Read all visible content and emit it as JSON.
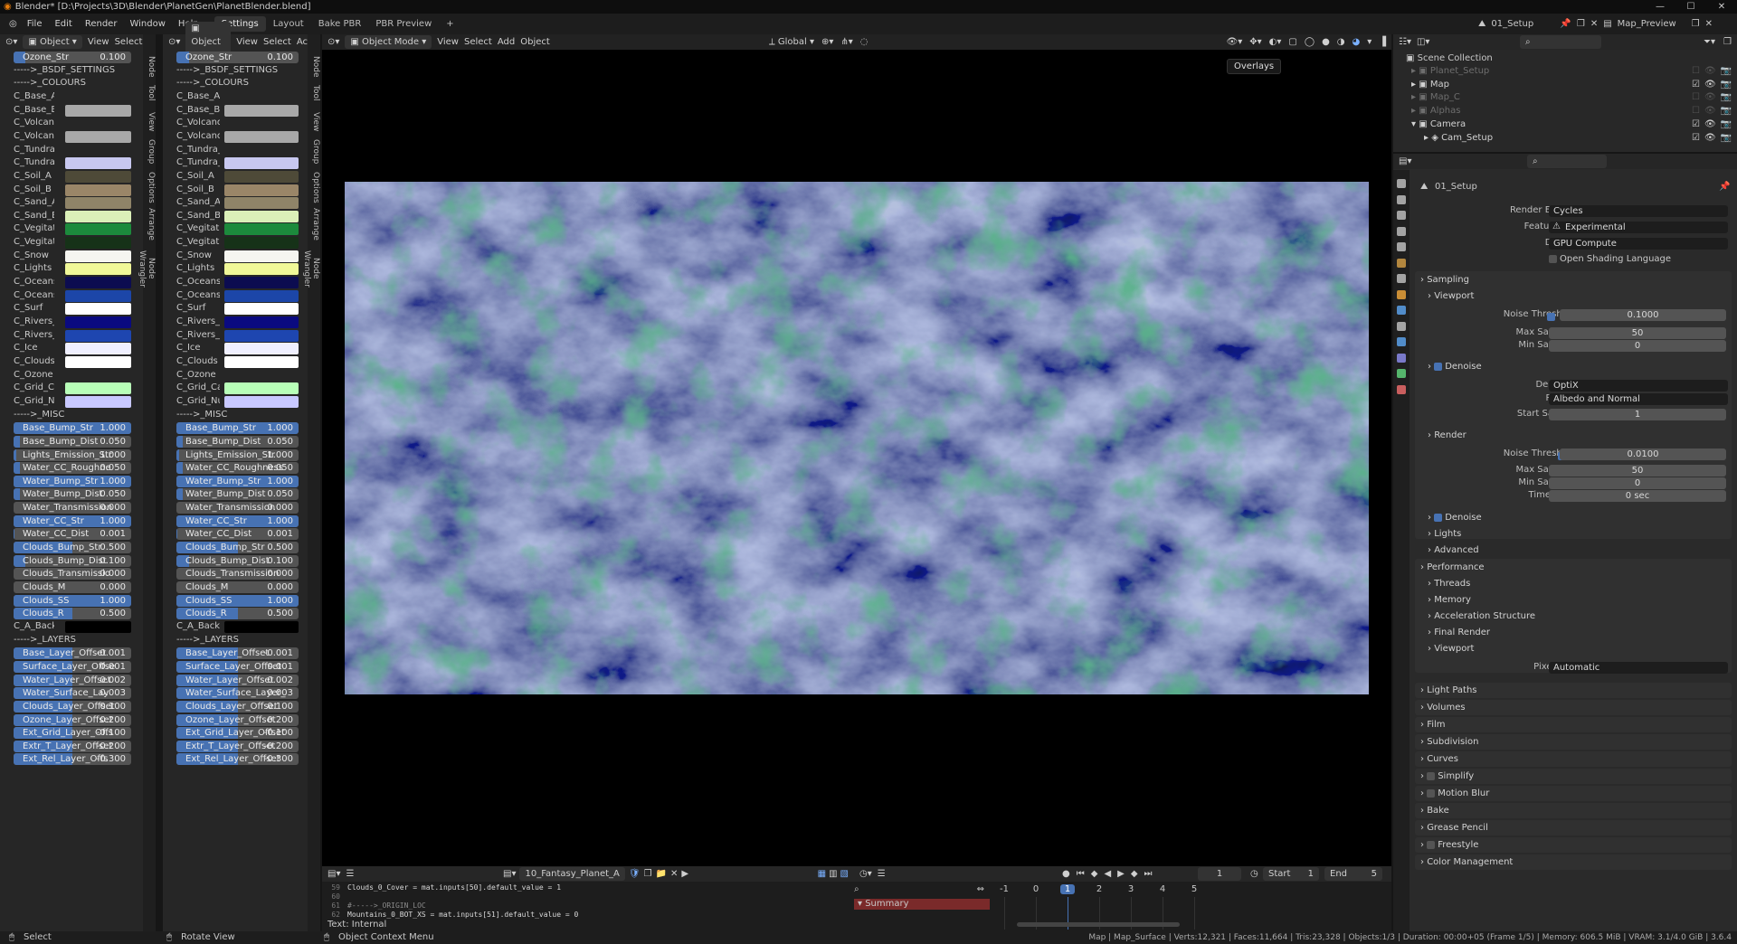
{
  "title": "Blender* [D:\\Projects\\3D\\Blender\\PlanetGen\\PlanetBlender.blend]",
  "menu": [
    "File",
    "Edit",
    "Render",
    "Window",
    "Help"
  ],
  "workspaces": [
    "Settings",
    "Layout",
    "Bake PBR",
    "PBR Preview"
  ],
  "scene": "01_Setup",
  "view_layer": "Map_Preview",
  "left_panels": [
    {
      "header": {
        "mode": "Object",
        "view": "View",
        "select": "Select"
      }
    },
    {
      "header": {
        "mode": "Object",
        "view": "View",
        "select": "Select",
        "extra": "Ac"
      }
    }
  ],
  "panel_rows": [
    {
      "type": "slider",
      "label": "Ozone_Str",
      "value": "0.100",
      "fill": 0.1,
      "alt_label": "Ozone_Str"
    },
    {
      "type": "text",
      "label": "----->_BSDF_SETTINGS"
    },
    {
      "type": "text",
      "label": "----->_COLOURS"
    },
    {
      "type": "color",
      "label": "C_Base_A",
      "color": "#262626"
    },
    {
      "type": "color",
      "label": "C_Base_B",
      "color": "#a8a8a8"
    },
    {
      "type": "color",
      "label": "C_Volcan...",
      "alt_label": "C_Volcano...",
      "color": "#262626"
    },
    {
      "type": "color",
      "label": "C_Volcan...",
      "alt_label": "C_Volcano...",
      "color": "#a8a8a8"
    },
    {
      "type": "color",
      "label": "C_Tundra_A",
      "color": "#262626"
    },
    {
      "type": "color",
      "label": "C_Tundra_B",
      "color": "#c8c8f0"
    },
    {
      "type": "color",
      "label": "C_Soil_A",
      "color": "#4e4a38"
    },
    {
      "type": "color",
      "label": "C_Soil_B",
      "color": "#9a8668"
    },
    {
      "type": "color",
      "label": "C_Sand_A",
      "color": "#8f8468"
    },
    {
      "type": "color",
      "label": "C_Sand_B",
      "color": "#dbf0b8"
    },
    {
      "type": "color",
      "label": "C_Vegitati...",
      "color": "#1c8a3c"
    },
    {
      "type": "color",
      "label": "C_Vegitati...",
      "color": "#163218"
    },
    {
      "type": "color",
      "label": "C_Snow",
      "color": "#f5f5f0"
    },
    {
      "type": "color",
      "label": "C_Lights",
      "color": "#f0f898"
    },
    {
      "type": "color",
      "label": "C_Oceans_A",
      "color": "#0c0c50"
    },
    {
      "type": "color",
      "label": "C_Oceans_B",
      "color": "#1c46a8"
    },
    {
      "type": "color",
      "label": "C_Surf",
      "color": "#ffffff"
    },
    {
      "type": "color",
      "label": "C_Rivers_A",
      "color": "#0a0a80"
    },
    {
      "type": "color",
      "label": "C_Rivers_B",
      "color": "#1e46b0"
    },
    {
      "type": "color",
      "label": "C_Ice",
      "color": "#f0f0ff"
    },
    {
      "type": "color",
      "label": "C_Clouds",
      "color": "#ffffff"
    },
    {
      "type": "color",
      "label": "C_Ozone",
      "color": "#262626"
    },
    {
      "type": "color",
      "label": "C_Grid_Ca...",
      "alt_label": "C_Grid_Car...",
      "color": "#b8ffb8"
    },
    {
      "type": "color",
      "label": "C_Grid_Nu...",
      "color": "#c8c8ff"
    },
    {
      "type": "text",
      "label": "----->_MISC"
    },
    {
      "type": "slider",
      "label": "Base_Bump_Str",
      "value": "1.000",
      "fill": 1
    },
    {
      "type": "slider",
      "label": "Base_Bump_Dist",
      "value": "0.050",
      "fill": 0.05
    },
    {
      "type": "slider",
      "label": "Lights_Emission_Str",
      "value": "1.000",
      "fill": 0.02
    },
    {
      "type": "slider",
      "label": "Water_CC_Roughne",
      "alt_label": "Water_CC_Roughness",
      "value": "0.050",
      "fill": 0.05
    },
    {
      "type": "slider",
      "label": "Water_Bump_Str",
      "value": "1.000",
      "fill": 1
    },
    {
      "type": "slider",
      "label": "Water_Bump_Dist",
      "value": "0.050",
      "fill": 0.05
    },
    {
      "type": "slider",
      "label": "Water_Transmission",
      "value": "0.000",
      "fill": 0
    },
    {
      "type": "slider",
      "label": "Water_CC_Str",
      "value": "1.000",
      "fill": 1
    },
    {
      "type": "slider",
      "label": "Water_CC_Dist",
      "value": "0.001",
      "fill": 0.001
    },
    {
      "type": "slider",
      "label": "Clouds_Bump_Str",
      "value": "0.500",
      "fill": 0.5
    },
    {
      "type": "slider",
      "label": "Clouds_Bump_Dist",
      "value": "0.100",
      "fill": 0.1
    },
    {
      "type": "slider",
      "label": "Clouds_Transmissio",
      "alt_label": "Clouds_Transmission",
      "value": "0.000",
      "fill": 0
    },
    {
      "type": "slider",
      "label": "Clouds_M",
      "value": "0.000",
      "fill": 0
    },
    {
      "type": "slider",
      "label": "Clouds_SS",
      "value": "1.000",
      "fill": 1
    },
    {
      "type": "slider",
      "label": "Clouds_R",
      "value": "0.500",
      "fill": 0.5
    },
    {
      "type": "color",
      "label": "C_A_Back...",
      "alt_label": "C_A_Backg...",
      "color": "#000000"
    },
    {
      "type": "text",
      "label": "----->_LAYERS"
    },
    {
      "type": "slider",
      "label": "Base_Layer_Offset",
      "value": "-0.001",
      "fill": 0.5
    },
    {
      "type": "slider",
      "label": "Surface_Layer_Offse",
      "alt_label": "Surface_Layer_Offset",
      "value": "0.001",
      "fill": 0.5
    },
    {
      "type": "slider",
      "label": "Water_Layer_Offset",
      "value": "0.002",
      "fill": 0.5
    },
    {
      "type": "slider",
      "label": "Water_Surface_Lay",
      "alt_label": "Water_Surface_Layer_",
      "value": "0.003",
      "fill": 0.5
    },
    {
      "type": "slider",
      "label": "Clouds_Layer_Offset",
      "value": "0.100",
      "fill": 0.5
    },
    {
      "type": "slider",
      "label": "Ozone_Layer_Offset",
      "value": "0.200",
      "fill": 0.5
    },
    {
      "type": "slider",
      "label": "Ext_Grid_Layer_Offs",
      "alt_label": "Ext_Grid_Layer_Offset",
      "value": "-0.100",
      "fill": 0.5
    },
    {
      "type": "slider",
      "label": "Extr_T_Layer_Offset",
      "value": "-0.200",
      "fill": 0.5
    },
    {
      "type": "slider",
      "label": "Ext_Rel_Layer_Offs",
      "alt_label": "Ext_Rel_Layer_Offset",
      "value": "-0.300",
      "fill": 0.5
    }
  ],
  "side_tabs": [
    "Node",
    "Tool",
    "View",
    "Group",
    "Options",
    "Arrange",
    "Node Wrangler"
  ],
  "viewport": {
    "mode": "Object Mode",
    "menus": [
      "View",
      "Select",
      "Add",
      "Object"
    ],
    "transform": "Global",
    "tooltip": "Overlays"
  },
  "outliner": {
    "root": "Scene Collection",
    "items": [
      {
        "name": "Planet_Setup",
        "indent": 1,
        "dim": true
      },
      {
        "name": "Map",
        "indent": 1,
        "dim": false
      },
      {
        "name": "Map_C",
        "indent": 1,
        "dim": true
      },
      {
        "name": "Alphas",
        "indent": 1,
        "dim": true
      },
      {
        "name": "Camera",
        "indent": 1,
        "dim": false
      },
      {
        "name": "Cam_Setup",
        "indent": 2,
        "dim": false
      }
    ]
  },
  "properties": {
    "scene_name": "01_Setup",
    "render_engine_label": "Render Engine",
    "render_engine": "Cycles",
    "feature_set_label": "Feature Set",
    "feature_set": "Experimental",
    "device_label": "Device",
    "device": "GPU Compute",
    "osl": "Open Shading Language",
    "sampling": "Sampling",
    "viewport": "Viewport",
    "noise_threshold_label": "Noise Threshold",
    "vp_noise": "0.1000",
    "max_samples_label": "Max Samples",
    "vp_max": "50",
    "min_samples_label": "Min Samples",
    "vp_min": "0",
    "denoise": "Denoise",
    "denoiser_label": "Denoiser",
    "denoiser": "OptiX",
    "passes_label": "Passes",
    "passes": "Albedo and Normal",
    "start_sample_label": "Start Sample",
    "start_sample": "1",
    "render": "Render",
    "r_noise": "0.0100",
    "r_max": "50",
    "r_min": "0",
    "time_limit_label": "Time Limit",
    "time_limit": "0 sec",
    "lights": "Lights",
    "advanced": "Advanced",
    "performance": "Performance",
    "threads": "Threads",
    "memory": "Memory",
    "accel": "Acceleration Structure",
    "final_render": "Final Render",
    "perf_viewport": "Viewport",
    "pixel_size_label": "Pixel Size",
    "pixel_size": "Automatic",
    "light_paths": "Light Paths",
    "volumes": "Volumes",
    "film": "Film",
    "subdivision": "Subdivision",
    "curves": "Curves",
    "simplify": "Simplify",
    "motion_blur": "Motion Blur",
    "bake": "Bake",
    "grease_pencil": "Grease Pencil",
    "freestyle": "Freestyle",
    "color_management": "Color Management"
  },
  "text_editor": {
    "file": "10_Fantasy_Planet_A",
    "lines": [
      {
        "n": "59",
        "code": "Clouds_0_Cover = mat.inputs[50].default_value = 1"
      },
      {
        "n": "60",
        "code": ""
      },
      {
        "n": "61",
        "code": "#----->_ORIGIN_LOC"
      },
      {
        "n": "62",
        "code": "Mountains_0_BOT_XS = mat.inputs[51].default_value = 0"
      }
    ],
    "footer": "Text: Internal"
  },
  "timeline": {
    "summary": "Summary",
    "frame": "1",
    "start_label": "Start",
    "start": "1",
    "end_label": "End",
    "end": "5",
    "ticks": [
      "-1",
      "0",
      "1",
      "2",
      "3",
      "4",
      "5"
    ]
  },
  "status": {
    "select": "Select",
    "rotate": "Rotate View",
    "context": "Object Context Menu",
    "info": "Map | Map_Surface | Verts:12,321 | Faces:11,664 | Tris:23,328 | Objects:1/3 | Duration: 00:00+05 (Frame 1/5) | Memory: 606.5 MiB | VRAM: 3.1/4.0 GiB | 3.6.4"
  },
  "colors": {
    "accent": "#4772b3",
    "panel": "#262626",
    "viewport": "#000000"
  }
}
